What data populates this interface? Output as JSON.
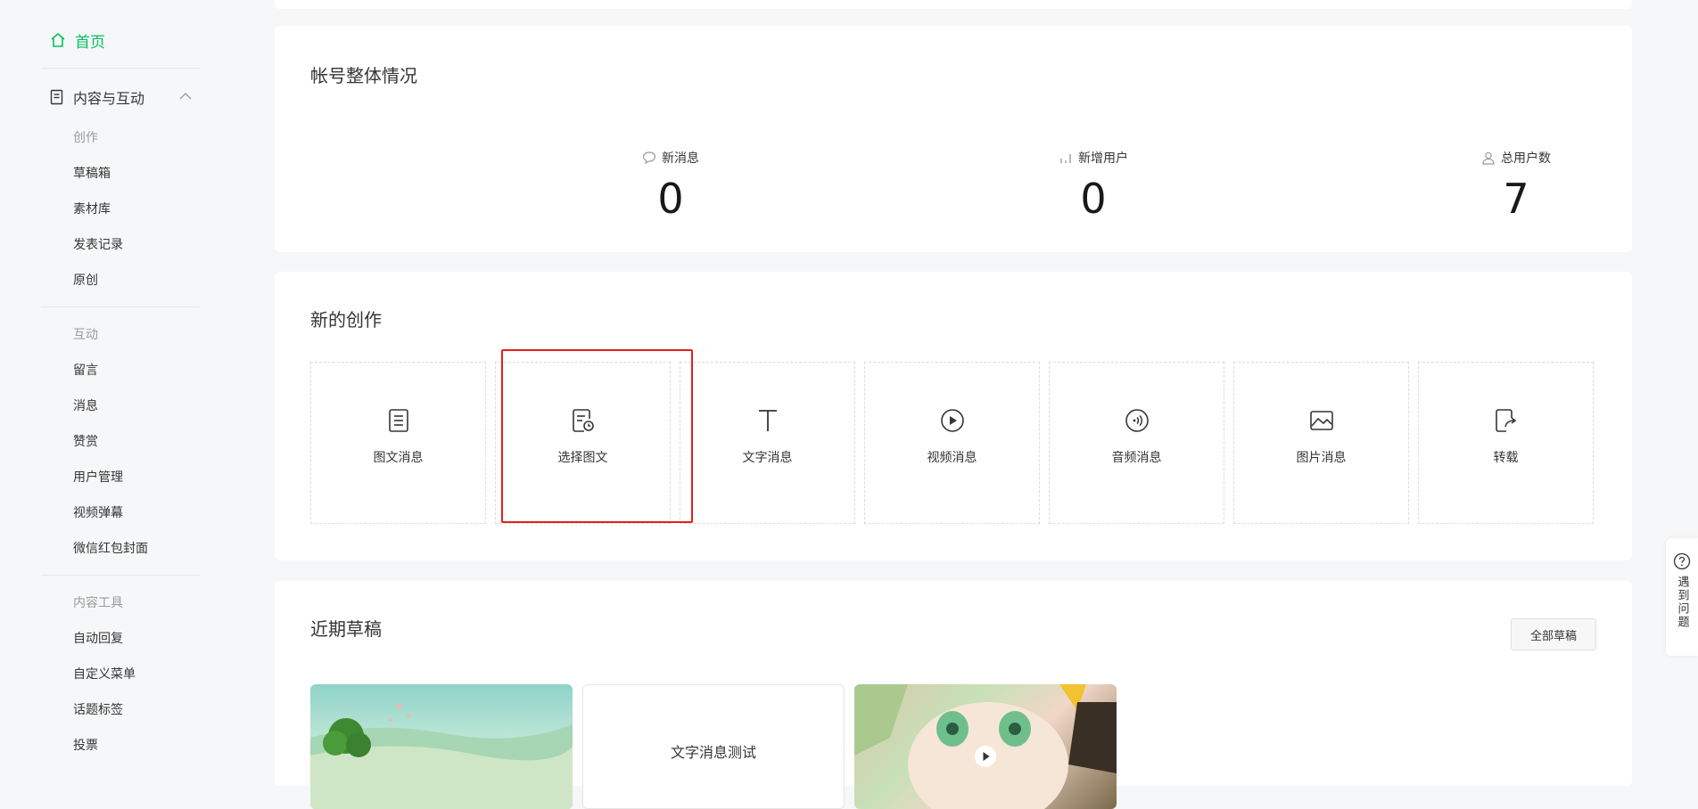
{
  "sidebar": {
    "home_label": "首页",
    "group_label": "内容与互动",
    "sections": [
      {
        "title": "创作",
        "items": [
          "草稿箱",
          "素材库",
          "发表记录",
          "原创"
        ]
      },
      {
        "title": "互动",
        "items": [
          "留言",
          "消息",
          "赞赏",
          "用户管理",
          "视频弹幕",
          "微信红包封面"
        ]
      },
      {
        "title": "内容工具",
        "items": [
          "自动回复",
          "自定义菜单",
          "话题标签",
          "投票"
        ]
      }
    ]
  },
  "overview": {
    "title": "帐号整体情况",
    "stats": [
      {
        "label": "新消息",
        "value": "0",
        "icon": "chat-icon"
      },
      {
        "label": "新增用户",
        "value": "0",
        "icon": "bar-chart-icon"
      },
      {
        "label": "总用户数",
        "value": "7",
        "icon": "user-icon"
      }
    ]
  },
  "create": {
    "title": "新的创作",
    "items": [
      {
        "label": "图文消息",
        "icon": "document-icon"
      },
      {
        "label": "选择图文",
        "icon": "document-clock-icon"
      },
      {
        "label": "文字消息",
        "icon": "text-icon"
      },
      {
        "label": "视频消息",
        "icon": "play-circle-icon"
      },
      {
        "label": "音频消息",
        "icon": "audio-circle-icon"
      },
      {
        "label": "图片消息",
        "icon": "image-icon"
      },
      {
        "label": "转载",
        "icon": "share-doc-icon"
      }
    ]
  },
  "drafts": {
    "title": "近期草稿",
    "all_button": "全部草稿",
    "items": [
      {
        "type": "image"
      },
      {
        "type": "text",
        "text": "文字消息测试"
      },
      {
        "type": "video"
      }
    ]
  },
  "help": {
    "label": "遇到问题"
  },
  "colors": {
    "accent": "#07c160",
    "highlight": "#e02020"
  }
}
